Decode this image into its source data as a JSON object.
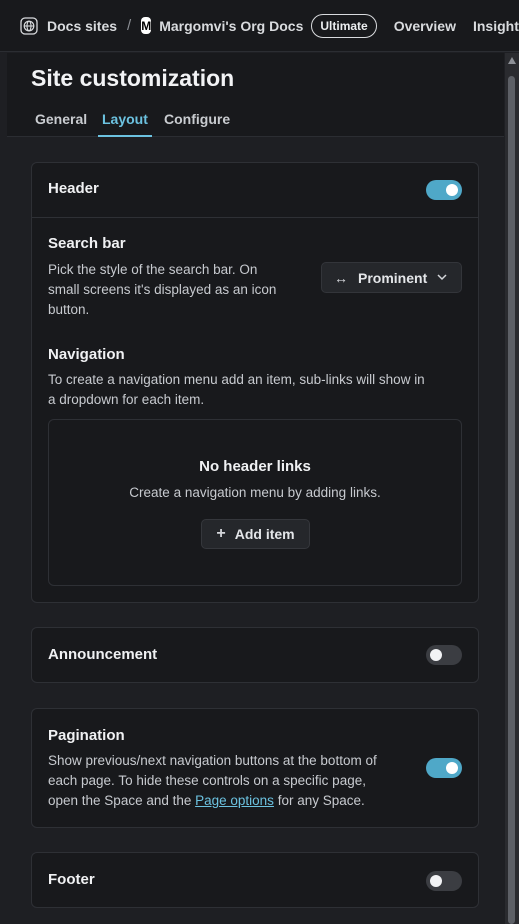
{
  "topbar": {
    "breadcrumb_root": "Docs sites",
    "separator": "/",
    "org_logo_letter": "M",
    "org_name": "Margomvi's Org Docs",
    "plan_badge": "Ultimate",
    "nav": [
      "Overview",
      "Insights"
    ]
  },
  "page": {
    "title": "Site customization",
    "tabs": [
      {
        "label": "General",
        "active": false
      },
      {
        "label": "Layout",
        "active": true
      },
      {
        "label": "Configure",
        "active": false
      }
    ]
  },
  "header_card": {
    "title": "Header",
    "enabled": true,
    "search": {
      "title": "Search bar",
      "description_lines": [
        "Pick the style of the search bar. On",
        "small screens it's displayed as an icon",
        "button."
      ],
      "style_value": "Prominent"
    },
    "navigation": {
      "title": "Navigation",
      "description_lines": [
        "To create a navigation menu add an item, sub-links will show in",
        "a dropdown for each item."
      ],
      "empty_title": "No header links",
      "empty_description": "Create a navigation menu by adding links.",
      "add_label": "Add item"
    }
  },
  "announcement_card": {
    "title": "Announcement",
    "enabled": false
  },
  "pagination_card": {
    "title": "Pagination",
    "enabled": true,
    "line1": "Show previous/next navigation buttons at the bottom of",
    "line2": "each page. To hide these controls on a specific page,",
    "line3_before": "open the Space and the ",
    "line3_link": "Page options",
    "line3_after": " for any Space."
  },
  "footer_card": {
    "title": "Footer",
    "enabled": false
  },
  "colors": {
    "accent": "#6cc2e0",
    "toggle_on": "#4fa8c8",
    "background": "#1e1f23"
  }
}
